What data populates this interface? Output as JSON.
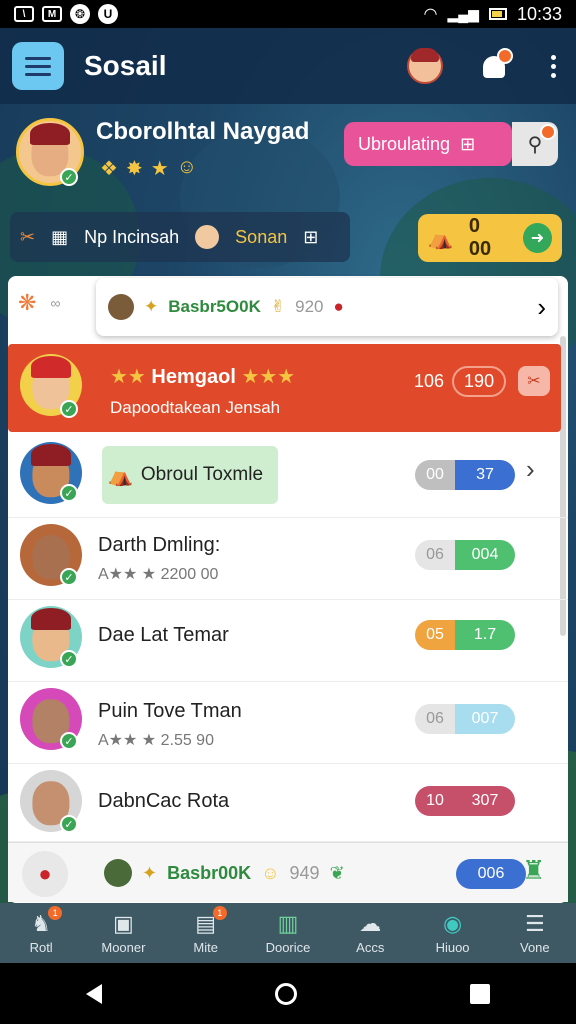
{
  "status_bar": {
    "time": "10:33"
  },
  "header": {
    "title": "Sosail"
  },
  "profile": {
    "name": "Cborolhtal Naygad",
    "action_label": "Ubroulating"
  },
  "info_strip": {
    "text": "Np Incinsah",
    "highlight": "Sonan",
    "coins": "0 00"
  },
  "popover": {
    "label": "Basbr5O0K",
    "count": "920"
  },
  "rows": [
    {
      "name": "Hemgaol",
      "sub": "Dapoodtakean Jensah",
      "n1": "106",
      "n2": "190"
    },
    {
      "card_label": "Obroul Toxmle",
      "n1": "00",
      "n2": "37"
    },
    {
      "name": "Darth Dmling:",
      "sub": "A★★ ★ 2200 00",
      "n1": "06",
      "n2": "004"
    },
    {
      "name": "Dae Lat Temar",
      "n1": "05",
      "n2": "1.7"
    },
    {
      "name": "Puin Tove Tman",
      "sub": "A★★ ★ 2.55 90",
      "n1": "06",
      "n2": "007"
    },
    {
      "name": "DabnCac Rota",
      "n1": "10",
      "n2": "307"
    }
  ],
  "promo": {
    "label": "Basbr00K",
    "count": "949",
    "value": "006"
  },
  "bottom_nav": [
    {
      "label": "Rotl"
    },
    {
      "label": "Mooner"
    },
    {
      "label": "Mite"
    },
    {
      "label": "Doorice"
    },
    {
      "label": "Accs"
    },
    {
      "label": "Hiuoo"
    },
    {
      "label": "Vone"
    }
  ],
  "colors": {
    "accent_red": "#e04a2a",
    "accent_pink": "#e9539a",
    "coin_yellow": "#f5c542",
    "success_green": "#33a85a"
  }
}
